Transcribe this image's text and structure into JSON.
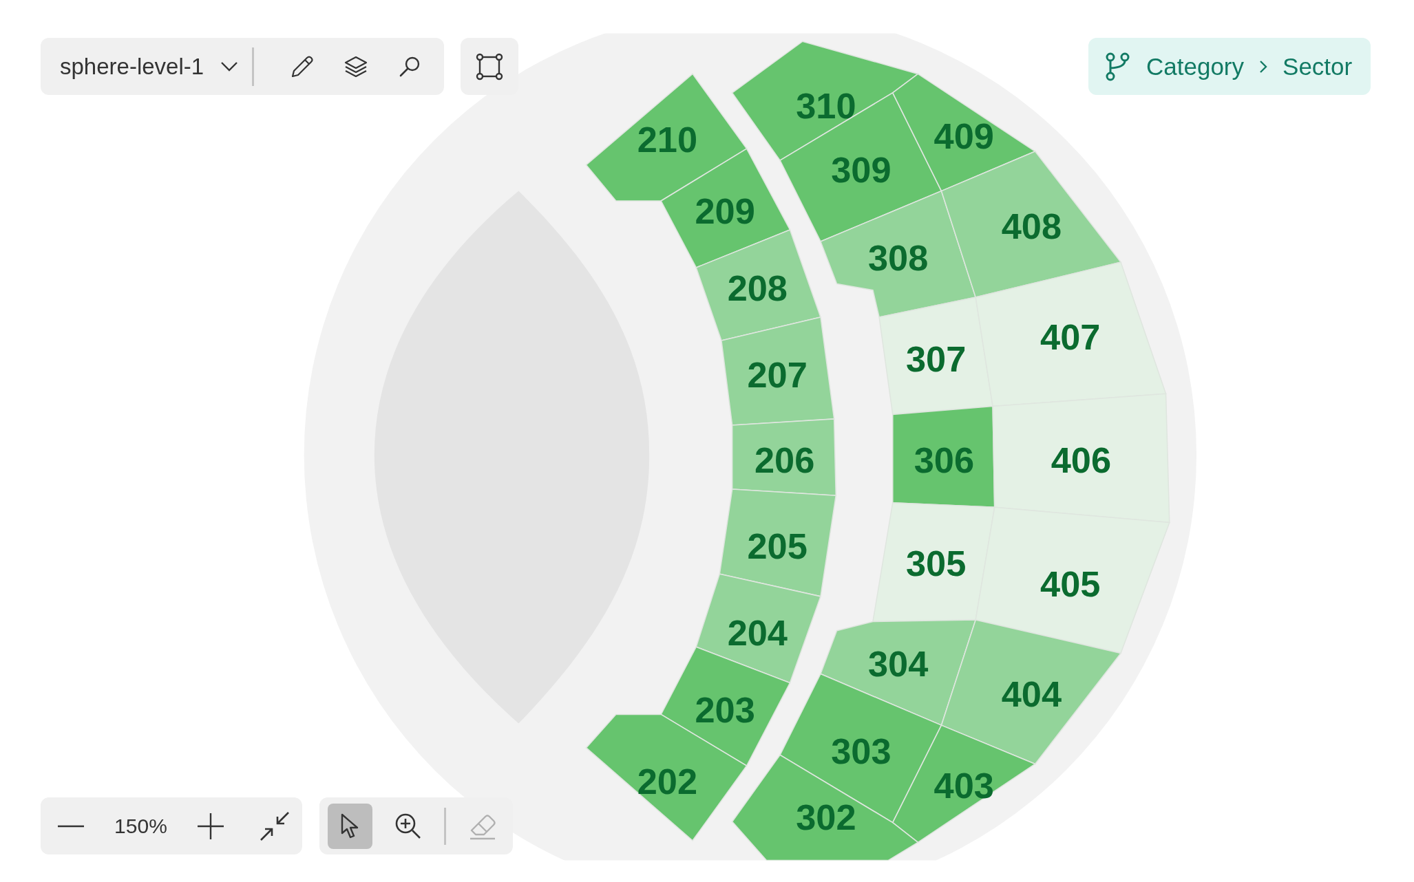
{
  "layer_select": {
    "value": "sphere-level-1"
  },
  "breadcrumb": [
    "Category",
    "Sector"
  ],
  "zoom": {
    "value": "150%"
  },
  "tools": [
    {
      "kind": "pointer",
      "selected": true,
      "disabled": false
    },
    {
      "kind": "zoom",
      "selected": false,
      "disabled": false
    },
    {
      "kind": "eraser",
      "selected": false,
      "disabled": true
    }
  ],
  "sections": [
    {
      "label": "210",
      "color": "#66c46e"
    },
    {
      "label": "209",
      "color": "#66c46e"
    },
    {
      "label": "208",
      "color": "#93d49a"
    },
    {
      "label": "207",
      "color": "#93d49a"
    },
    {
      "label": "206",
      "color": "#93d49a"
    },
    {
      "label": "205",
      "color": "#93d49a"
    },
    {
      "label": "204",
      "color": "#93d49a"
    },
    {
      "label": "203",
      "color": "#66c46e"
    },
    {
      "label": "202",
      "color": "#66c46e"
    },
    {
      "label": "310",
      "color": "#66c46e"
    },
    {
      "label": "309",
      "color": "#66c46e"
    },
    {
      "label": "409",
      "color": "#66c46e"
    },
    {
      "label": "308",
      "color": "#93d49a"
    },
    {
      "label": "408",
      "color": "#93d49a"
    },
    {
      "label": "307",
      "color": "#e4f1e5"
    },
    {
      "label": "407",
      "color": "#e4f1e5"
    },
    {
      "label": "306",
      "color": "#66c46e"
    },
    {
      "label": "406",
      "color": "#e4f1e5"
    },
    {
      "label": "305",
      "color": "#e4f1e5"
    },
    {
      "label": "405",
      "color": "#e4f1e5"
    },
    {
      "label": "304",
      "color": "#93d49a"
    },
    {
      "label": "404",
      "color": "#93d49a"
    },
    {
      "label": "303",
      "color": "#66c46e"
    },
    {
      "label": "403",
      "color": "#66c46e"
    },
    {
      "label": "302",
      "color": "#66c46e"
    }
  ]
}
